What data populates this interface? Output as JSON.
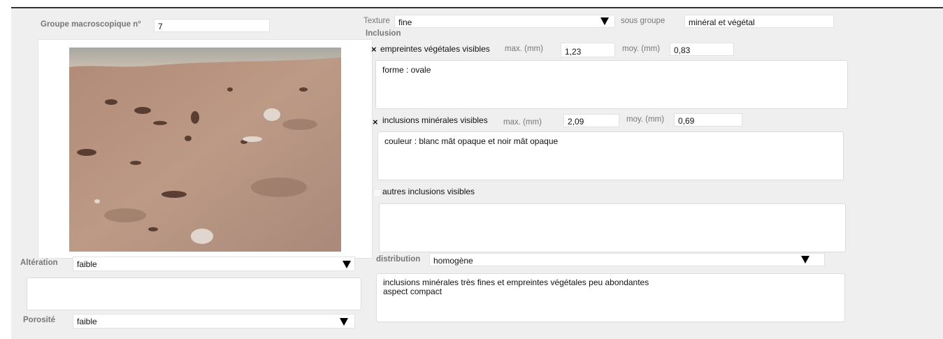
{
  "left": {
    "groupe_label": "Groupe macroscopique n°",
    "groupe_value": "7",
    "alteration_label": "Altération",
    "alteration_value": "faible",
    "porosite_label": "Porosité",
    "porosite_value": "faible"
  },
  "texture": {
    "label": "Texture",
    "value": "fine",
    "sous_groupe_label": "sous groupe",
    "sous_groupe_value": "minéral et végétal"
  },
  "inclusion": {
    "heading": "Inclusion",
    "vegetal": {
      "checked": true,
      "check_mark": "×",
      "label": "empreintes végétales visibles",
      "max_label": "max. (mm)",
      "max_value": "1,23",
      "moy_label": "moy. (mm)",
      "moy_value": "0,83",
      "notes": "forme : ovale"
    },
    "mineral": {
      "checked": true,
      "check_mark": "×",
      "label": "inclusions minérales visibles",
      "max_label": "max. (mm)",
      "max_value": "2,09",
      "moy_label": "moy. (mm)",
      "moy_value": "0,69",
      "notes": "couleur : blanc mât opaque et noir mât opaque"
    },
    "autres": {
      "checked": false,
      "label": "autres inclusions visibles",
      "notes": ""
    }
  },
  "distribution": {
    "label": "distribution",
    "value": "homogène",
    "notes_line1": "inclusions minérales très fines et empreintes végétales peu abondantes",
    "notes_line2": "aspect compact"
  },
  "colors": {
    "panel": "#efefef",
    "field": "#ffffff",
    "label": "#777777"
  }
}
